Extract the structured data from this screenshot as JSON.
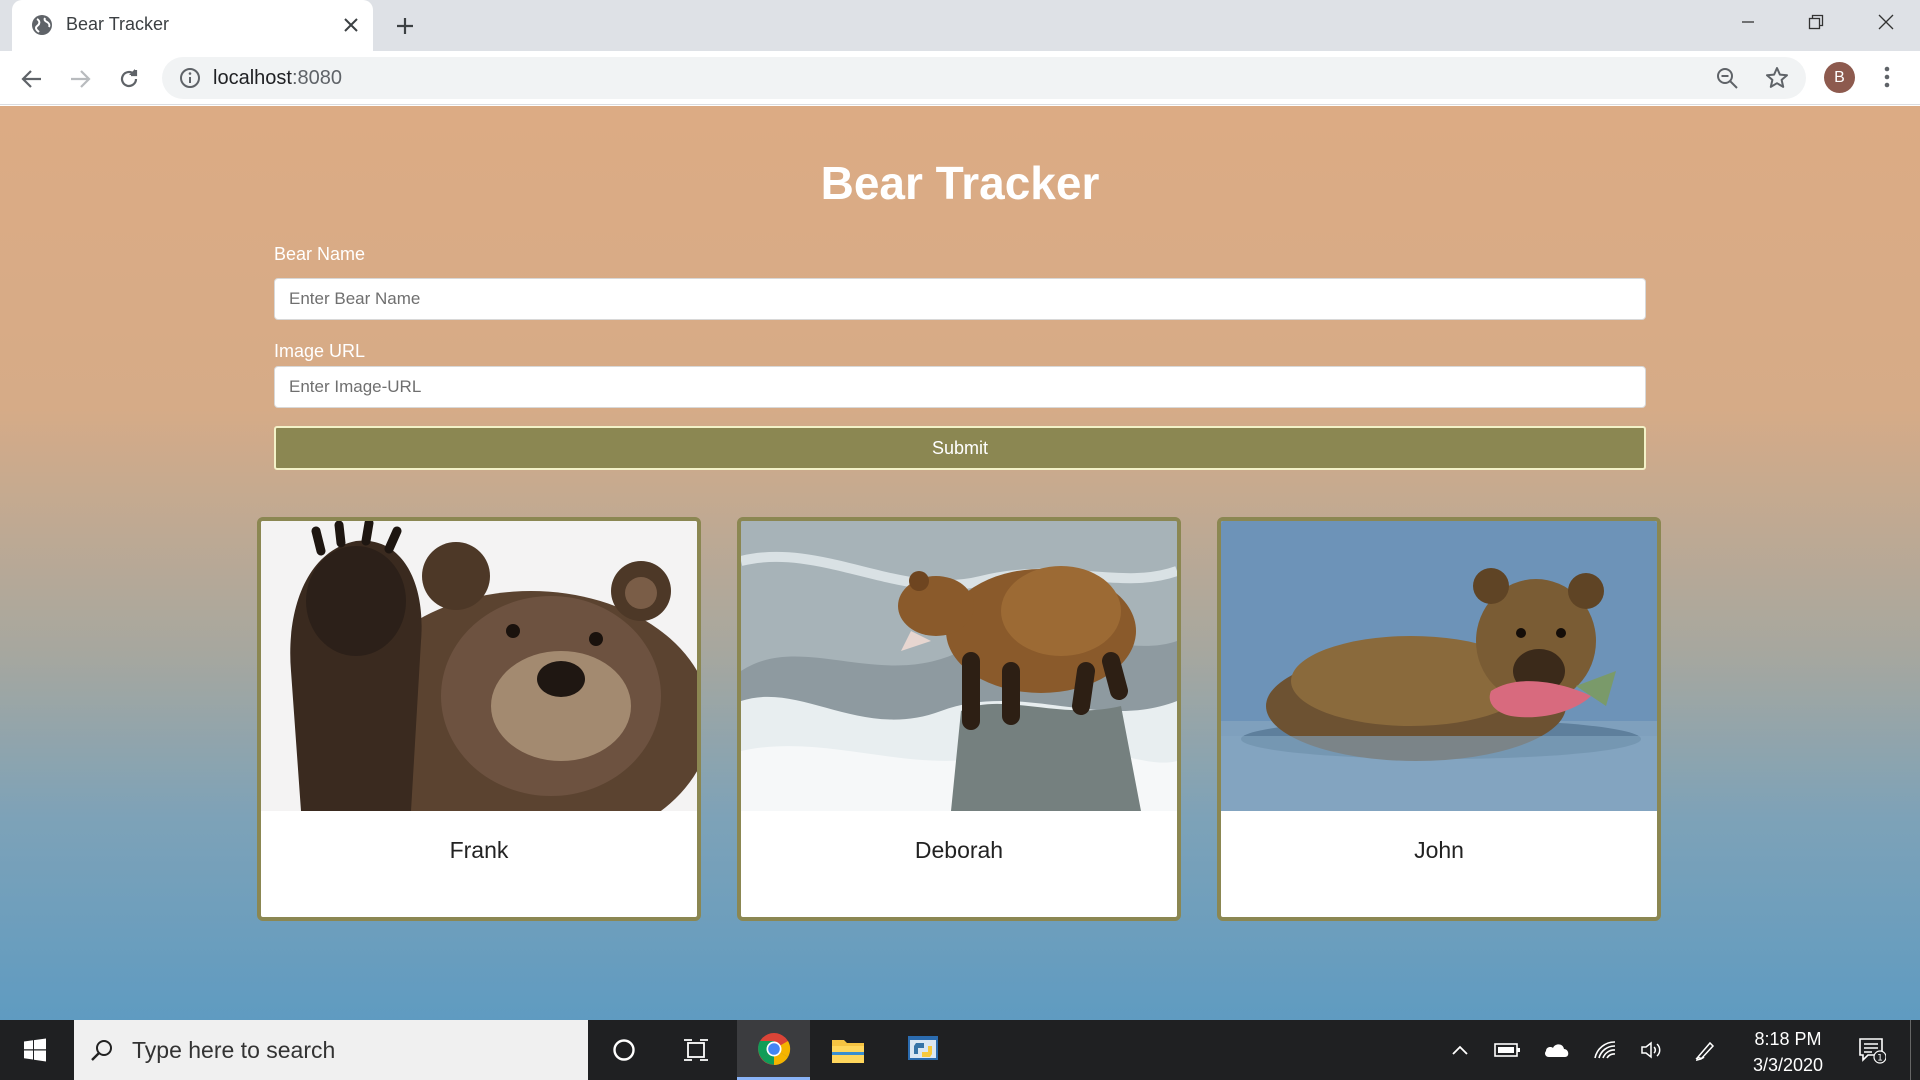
{
  "browser": {
    "tab_title": "Bear Tracker",
    "url_host": "localhost",
    "url_port": ":8080",
    "profile_initial": "B"
  },
  "app": {
    "title": "Bear Tracker",
    "name_field": {
      "label": "Bear Name",
      "placeholder": "Enter Bear Name",
      "value": ""
    },
    "image_field": {
      "label": "Image URL",
      "placeholder": "Enter Image-URL",
      "value": ""
    },
    "submit_label": "Submit",
    "bears": [
      {
        "name": "Frank"
      },
      {
        "name": "Deborah"
      },
      {
        "name": "John"
      }
    ]
  },
  "taskbar": {
    "search_placeholder": "Type here to search",
    "time": "8:18 PM",
    "date": "3/3/2020",
    "notification_count": "1"
  },
  "colors": {
    "accent": "#8b8752",
    "page_top": "#dcab84",
    "page_bottom": "#5f9bc1"
  }
}
